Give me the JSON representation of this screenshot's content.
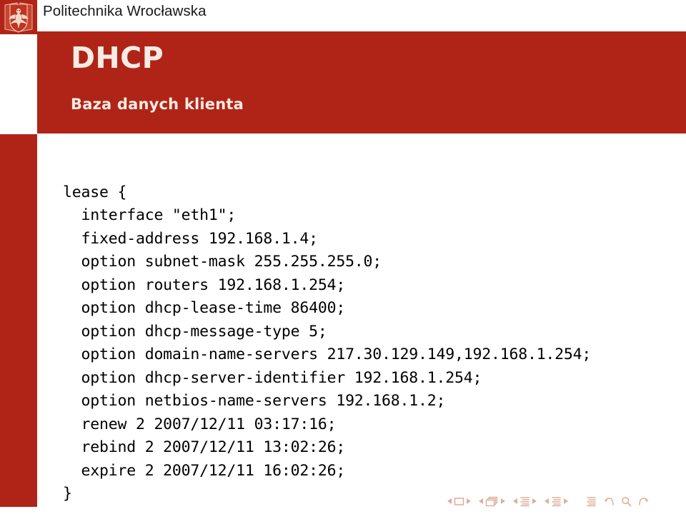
{
  "branding": {
    "institution": "Politechnika Wrocławska",
    "logo_icon": "wroclaw-university-of-technology-crest-icon",
    "accent_color": "#b02418",
    "title_text_color": "#f7ece3"
  },
  "header": {
    "title": "DHCP",
    "subtitle": "Baza danych klienta"
  },
  "code": {
    "language": "dhclient-lease",
    "lines": [
      "lease {",
      "  interface \"eth1\";",
      "  fixed-address 192.168.1.4;",
      "  option subnet-mask 255.255.255.0;",
      "  option routers 192.168.1.254;",
      "  option dhcp-lease-time 86400;",
      "  option dhcp-message-type 5;",
      "  option domain-name-servers 217.30.129.149,192.168.1.254;",
      "  option dhcp-server-identifier 192.168.1.254;",
      "  option netbios-name-servers 192.168.1.2;",
      "  renew 2 2007/12/11 03:17:16;",
      "  rebind 2 2007/12/11 13:02:26;",
      "  expire 2 2007/12/11 16:02:26;",
      "}"
    ]
  },
  "navigation": {
    "icon_color": "#dfae9c",
    "groups": [
      {
        "name": "slide",
        "icon": "slide-icon",
        "prev_label": "previous-slide",
        "next_label": "next-slide"
      },
      {
        "name": "frame",
        "icon": "frames-stack-icon",
        "prev_label": "previous-frame",
        "next_label": "next-frame"
      },
      {
        "name": "subsection",
        "icon": "subsection-lines-icon",
        "prev_label": "previous-subsection",
        "next_label": "next-subsection"
      },
      {
        "name": "section",
        "icon": "section-lines-icon",
        "prev_label": "previous-section",
        "next_label": "next-section"
      }
    ],
    "document_icon": "document-lines-icon",
    "extras": [
      {
        "name": "back",
        "icon": "back-arrow-icon"
      },
      {
        "name": "find",
        "icon": "magnifier-icon"
      },
      {
        "name": "forward",
        "icon": "forward-arrow-icon"
      }
    ]
  }
}
